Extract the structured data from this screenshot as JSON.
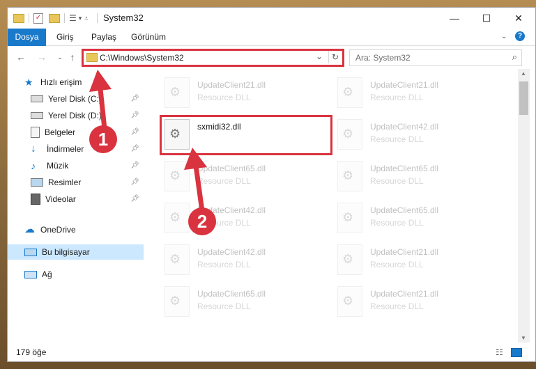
{
  "window": {
    "title": "System32",
    "controls": {
      "minimize": "—",
      "maximize": "☐",
      "close": "✕"
    }
  },
  "ribbon": {
    "tabs": [
      "Dosya",
      "Giriş",
      "Paylaş",
      "Görünüm"
    ],
    "help": "?"
  },
  "address": {
    "path": "C:\\Windows\\System32",
    "search_placeholder": "Ara: System32"
  },
  "navpane": {
    "items": [
      {
        "label": "Hızlı erişim",
        "icon": "star-icon"
      },
      {
        "label": "Yerel Disk (C:)",
        "icon": "drive-icon"
      },
      {
        "label": "Yerel Disk (D:)",
        "icon": "drive-icon"
      },
      {
        "label": "Belgeler",
        "icon": "documents-icon"
      },
      {
        "label": "İndirmeler",
        "icon": "download-icon"
      },
      {
        "label": "Müzik",
        "icon": "music-icon"
      },
      {
        "label": "Resimler",
        "icon": "pictures-icon"
      },
      {
        "label": "Videolar",
        "icon": "video-icon"
      },
      {
        "label": "OneDrive",
        "icon": "cloud-icon"
      },
      {
        "label": "Bu bilgisayar",
        "icon": "computer-icon"
      },
      {
        "label": "Ağ",
        "icon": "network-icon"
      }
    ]
  },
  "files": [
    {
      "name": "UpdateClient21.dll",
      "type": "Resource DLL"
    },
    {
      "name": "UpdateClient21.dll",
      "type": "Resource DLL"
    },
    {
      "name": "sxmidi32.dll",
      "type": ""
    },
    {
      "name": "UpdateClient42.dll",
      "type": "Resource DLL"
    },
    {
      "name": "UpdateClient65.dll",
      "type": "Resource DLL"
    },
    {
      "name": "UpdateClient65.dll",
      "type": "Resource DLL"
    },
    {
      "name": "UpdateClient42.dll",
      "type": "Resource DLL"
    },
    {
      "name": "UpdateClient65.dll",
      "type": "Resource DLL"
    },
    {
      "name": "UpdateClient42.dll",
      "type": "Resource DLL"
    },
    {
      "name": "UpdateClient21.dll",
      "type": "Resource DLL"
    },
    {
      "name": "UpdateClient65.dll",
      "type": "Resource DLL"
    },
    {
      "name": "UpdateClient21.dll",
      "type": "Resource DLL"
    }
  ],
  "status": {
    "count": "179 öğe"
  },
  "annotations": {
    "step1": "1",
    "step2": "2",
    "color": "#d9333f"
  }
}
